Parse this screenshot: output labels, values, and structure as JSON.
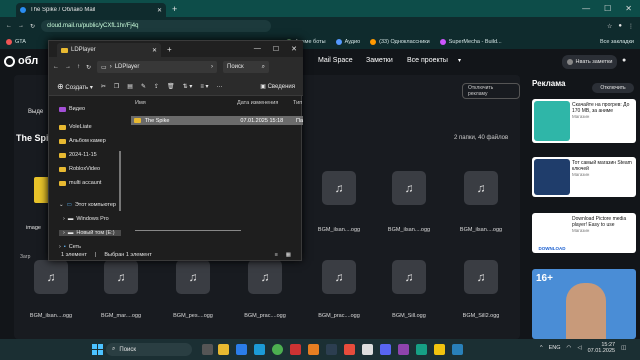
{
  "browser": {
    "tab_title": "The Spike / Облако Mail",
    "new_tab": "+",
    "url": "cloud.mail.ru/public/yCXfL1hr/Fj4q",
    "window": {
      "min": "—",
      "max": "☐",
      "close": "✕"
    }
  },
  "bookmarks": [
    {
      "label": "GTA"
    },
    {
      "label": "Аниме боты"
    },
    {
      "label": "Аудио"
    },
    {
      "label": "(33) Одноклассники"
    },
    {
      "label": "SuperMecha - Build..."
    }
  ],
  "bookmarks_right": "Все закладки",
  "site": {
    "logo": "обл",
    "nav": [
      "Mail Space",
      "Заметки",
      "Все проекты"
    ],
    "unlock": "Нвать заметки"
  },
  "page": {
    "sidebar_label": "Выде",
    "title": "The Spi",
    "refresh": "Отключить рекламу",
    "count": "2 папки, 40 файлов",
    "left_file": "image",
    "left_file2": "Загр"
  },
  "files_row1": [
    "BGM_ilsan....ogg",
    "BGM_ilsan....ogg",
    "BGM_ilsan....ogg",
    "BGM_ilsan....ogg"
  ],
  "files_row2": [
    "BGM_ilsan....ogg",
    "BGM_mar....ogg",
    "BGM_pes....ogg",
    "BGM_prac....ogg",
    "BGM_prac....ogg",
    "BGM_Sill.ogg",
    "BGM_Sill2.ogg"
  ],
  "ads": {
    "title": "Реклама",
    "disable": "Отключить",
    "card1": "Скачайте на прогрев: До 170 МВ, за аниме",
    "card1_sub": "Магазин",
    "card2": "Тот самый магазин Steam ключей",
    "card2_sub": "Магазин",
    "card3": "Download Pictore media player! Easy to use",
    "card3_sub": "Магазин",
    "card3_img": "DOWNLOAD",
    "age": "16+"
  },
  "explorer": {
    "tab": "LDPlayer",
    "path": "LDPlayer",
    "search": "Поиск",
    "create": "Создать",
    "sort": "Сортировать",
    "view": "Вид",
    "details": "Сведения",
    "sidebar": [
      "Видео",
      "VoleLiate",
      "Альбом камер",
      "2024-11-15",
      "RobloxVideo",
      "multi accaunt",
      "Этот компьютер",
      "Windows Pro",
      "Новый том (E:)",
      "Сеть"
    ],
    "columns": {
      "name": "Имя",
      "date": "Дата изменения",
      "type": "Тип"
    },
    "rows": [
      {
        "name": "The Spike",
        "date": "07.01.2025 15:18",
        "type": "Па"
      }
    ],
    "status_items": "1 элемент",
    "status_selected": "Выбран 1 элемент"
  },
  "taskbar": {
    "search": "Поиск",
    "lang": "ENG",
    "time": "15:27",
    "date": "07.01.2025"
  }
}
